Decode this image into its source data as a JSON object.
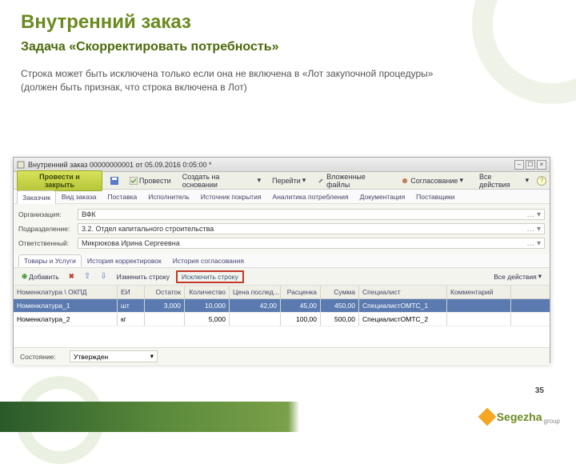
{
  "slide": {
    "title": "Внутренний заказ",
    "task": "Задача «Скорректировать потребность»",
    "desc": "Строка может быть исключена только если она не включена в «Лот закупочной процедуры» (должен быть признак, что строка включена в Лот)",
    "page": "35"
  },
  "window": {
    "title": "Внутренний заказ 00000000001 от 05.09.2016 0:05:00 *"
  },
  "toolbar": {
    "primary": "Провести и закрыть",
    "post": "Провести",
    "create_based": "Создать на основании",
    "goto": "Перейти",
    "attach": "Вложенные файлы",
    "approve": "Согласование",
    "all_actions": "Все действия"
  },
  "tabs": {
    "t1": "Заказчик",
    "t2": "Вид заказа",
    "t3": "Поставка",
    "t4": "Исполнитель",
    "t5": "Источник покрытия",
    "t6": "Аналитика потребления",
    "t7": "Документация",
    "t8": "Поставщики"
  },
  "form": {
    "org_label": "Организация:",
    "org_value": "ВФК",
    "dept_label": "Подразделение:",
    "dept_value": "3.2. Отдел капитального строительства",
    "resp_label": "Ответственный:",
    "resp_value": "Микрюкова Ирина Сергеевна"
  },
  "subtabs": {
    "s1": "Товары и Услуги",
    "s2": "История корректировок",
    "s3": "История согласования"
  },
  "gridbar": {
    "add": "Добавить",
    "edit": "Изменить строку",
    "exclude": "Исключить строку",
    "all": "Все действия"
  },
  "grid": {
    "h": {
      "name": "Номенклатура \\ ОКПД",
      "unit": "ЕИ",
      "bal": "Остаток",
      "qty": "Количество",
      "price": "Цена послед...",
      "disc": "Расценка",
      "sum": "Сумма",
      "spec": "Специалист",
      "comm": "Комментарий"
    },
    "rows": [
      {
        "name": "Номенклатура_1",
        "unit": "шт",
        "bal": "3,000",
        "qty": "10,000",
        "price": "42,00",
        "disc": "45,00",
        "sum": "450,00",
        "spec": "СпециалистОМТС_1",
        "comm": ""
      },
      {
        "name": "Номенклатура_2",
        "unit": "кг",
        "bal": "",
        "qty": "5,000",
        "price": "",
        "disc": "100,00",
        "sum": "500,00",
        "spec": "СпециалистОМТС_2",
        "comm": ""
      }
    ]
  },
  "status": {
    "label": "Состояние:",
    "value": "Утвержден"
  },
  "brand": {
    "name": "Segezha",
    "sub": "group"
  }
}
